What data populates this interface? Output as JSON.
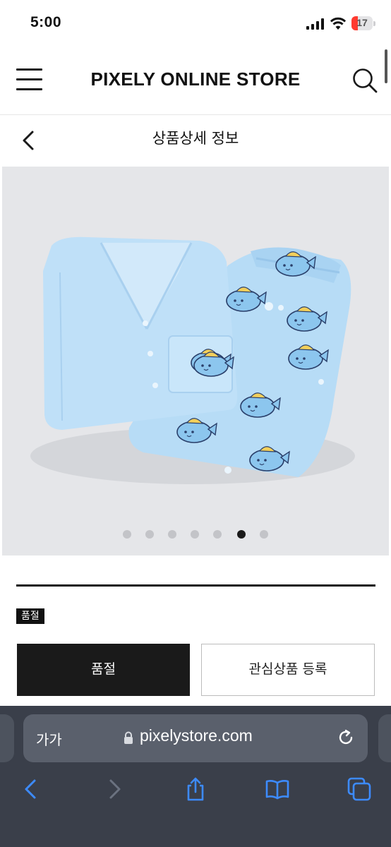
{
  "status_bar": {
    "time": "5:00",
    "battery_level": "17",
    "icons": [
      "signal-icon",
      "wifi-icon",
      "battery-icon"
    ]
  },
  "header": {
    "brand": "PIXELY ONLINE STORE",
    "icons": [
      "menu-icon",
      "search-icon"
    ]
  },
  "subheader": {
    "title": "상품상세 정보",
    "icons": [
      "back-icon"
    ]
  },
  "gallery": {
    "total_images": 7,
    "active_index": 5
  },
  "product": {
    "status_badge": "품절"
  },
  "actions": {
    "primary_label": "품절",
    "secondary_label": "관심상품 등록"
  },
  "browser": {
    "text_size_label": "가가",
    "url": "pixelystore.com",
    "icons": [
      "lock-icon",
      "reload-icon",
      "back-arrow-icon",
      "forward-arrow-icon",
      "share-icon",
      "bookmarks-icon",
      "tabs-icon"
    ],
    "colors": {
      "chrome_bg": "#3a3f4a",
      "active_icon": "#3d8bff",
      "disabled_icon": "#6b7280"
    }
  }
}
